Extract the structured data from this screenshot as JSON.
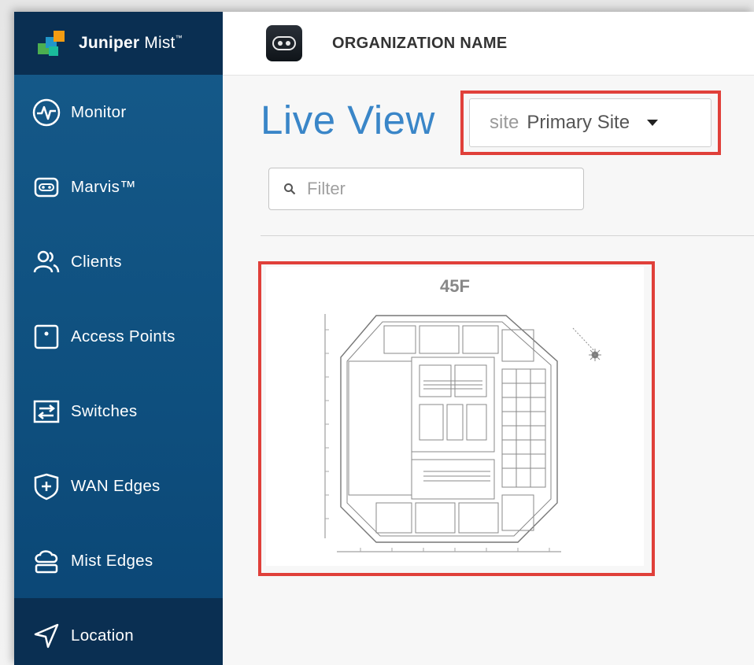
{
  "brand": {
    "name_bold": "Juniper",
    "name_light": " Mist",
    "trademark": "™"
  },
  "header": {
    "org_name": "ORGANIZATION NAME"
  },
  "sidebar": {
    "items": [
      {
        "label": "Monitor",
        "icon": "monitor-icon"
      },
      {
        "label": "Marvis™",
        "icon": "marvis-icon"
      },
      {
        "label": "Clients",
        "icon": "clients-icon"
      },
      {
        "label": "Access Points",
        "icon": "access-point-icon"
      },
      {
        "label": "Switches",
        "icon": "switches-icon"
      },
      {
        "label": "WAN Edges",
        "icon": "wan-edge-icon"
      },
      {
        "label": "Mist Edges",
        "icon": "mist-edge-icon"
      },
      {
        "label": "Location",
        "icon": "location-icon",
        "active": true
      }
    ]
  },
  "main": {
    "title": "Live View",
    "site_selector": {
      "prefix": "site",
      "value": "Primary Site"
    },
    "filter": {
      "placeholder": "Filter",
      "value": ""
    },
    "maps": [
      {
        "label": "45F"
      }
    ]
  },
  "colors": {
    "sidebar": "#0e4f7e",
    "sidebar_active": "#0a2f52",
    "title": "#3a86c8",
    "highlight": "#e0403a"
  }
}
